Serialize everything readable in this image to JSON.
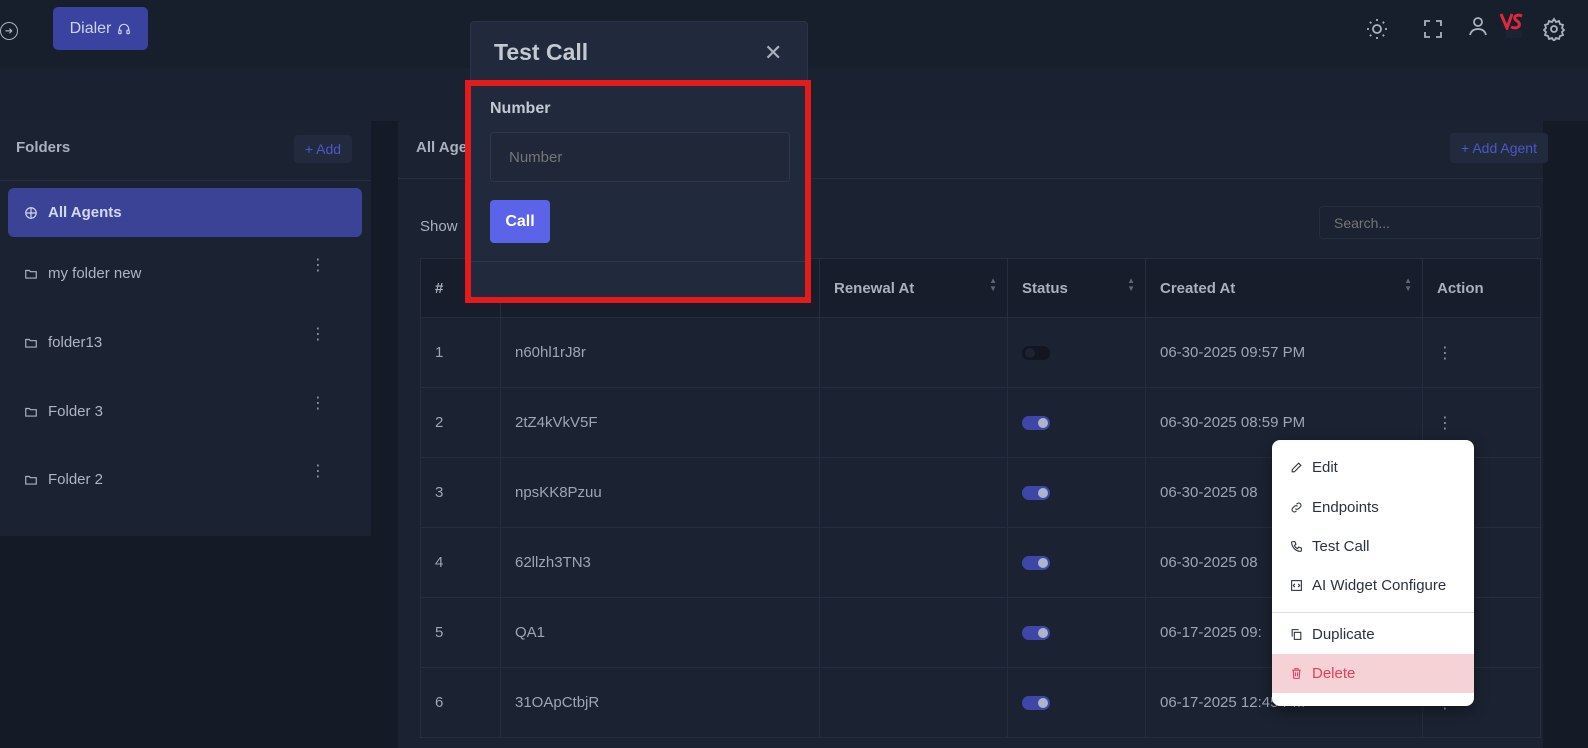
{
  "topbar": {
    "dialer_label": "Dialer",
    "icons": [
      "circle-arrow-icon",
      "headset-icon",
      "sun-icon",
      "fullscreen-icon",
      "user-icon",
      "logo",
      "gear-icon"
    ]
  },
  "folders": {
    "title": "Folders",
    "add_label": "+ Add",
    "items": [
      {
        "label": "All Agents",
        "active": true
      },
      {
        "label": "my folder new"
      },
      {
        "label": "folder13"
      },
      {
        "label": "Folder 3"
      },
      {
        "label": "Folder 2"
      }
    ]
  },
  "agents": {
    "title": "All Age",
    "add_label": "+ Add Agent",
    "show_label": "Show",
    "search_placeholder": "Search...",
    "columns": [
      "#",
      "",
      "Renewal At",
      "Status",
      "Created At",
      "Action"
    ],
    "rows": [
      {
        "num": "1",
        "name": "n60hl1rJ8r",
        "renewal": "",
        "status": false,
        "created": "06-30-2025 09:57 PM"
      },
      {
        "num": "2",
        "name": "2tZ4kVkV5F",
        "renewal": "",
        "status": true,
        "created": "06-30-2025 08:59 PM"
      },
      {
        "num": "3",
        "name": "npsKK8Pzuu",
        "renewal": "",
        "status": true,
        "created": "06-30-2025 08"
      },
      {
        "num": "4",
        "name": "62llzh3TN3",
        "renewal": "",
        "status": true,
        "created": "06-30-2025 08"
      },
      {
        "num": "5",
        "name": "QA1",
        "renewal": "",
        "status": true,
        "created": "06-17-2025 09:"
      },
      {
        "num": "6",
        "name": "31OApCtbjR",
        "renewal": "",
        "status": true,
        "created": "06-17-2025 12:45 PM"
      }
    ]
  },
  "modal": {
    "title": "Test Call",
    "field_label": "Number",
    "field_placeholder": "Number",
    "call_label": "Call"
  },
  "menu": {
    "items": [
      {
        "label": "Edit",
        "icon": "edit-icon"
      },
      {
        "label": "Endpoints",
        "icon": "link-icon"
      },
      {
        "label": "Test Call",
        "icon": "phone-icon"
      },
      {
        "label": "AI Widget Configure",
        "icon": "code-icon"
      },
      {
        "label": "Duplicate",
        "icon": "copy-icon"
      },
      {
        "label": "Delete",
        "icon": "trash-icon"
      }
    ]
  },
  "colors": {
    "accent": "#5b63e8",
    "highlight": "#e31b1b",
    "danger": "#e2405a"
  }
}
